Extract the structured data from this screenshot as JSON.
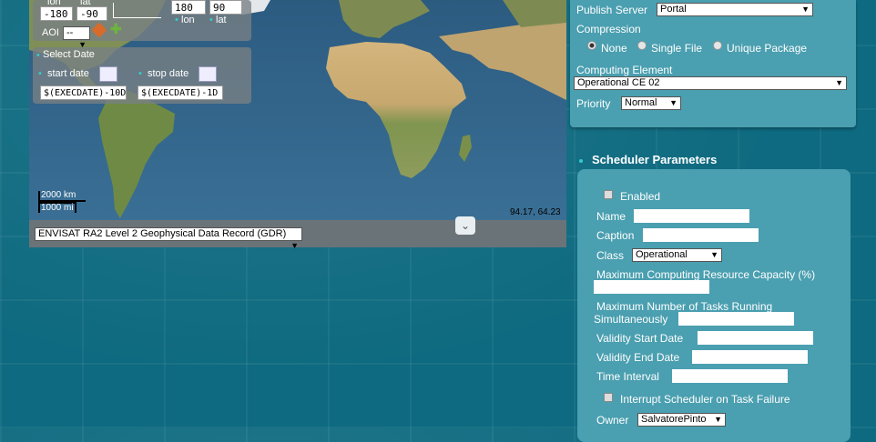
{
  "map": {
    "aoi": {
      "lon_label": "lon",
      "lat_label": "lat",
      "min_lon": "-180",
      "min_lat": "-90",
      "max_lon": "180",
      "max_lat": "90",
      "aoi_label": "AOI",
      "aoi_value": "--"
    },
    "select_date": {
      "title": "Select Date",
      "start_label": "start date",
      "stop_label": "stop date",
      "start_value": "$(EXECDATE)-10D",
      "stop_value": "$(EXECDATE)-1D"
    },
    "scale": {
      "km": "2000 km",
      "mi": "1000 mi"
    },
    "coords": "94.17, 64.23",
    "dataset": "ENVISAT RA2 Level 2 Geophysical Data Record (GDR)"
  },
  "publish": {
    "server_label": "Publish Server",
    "server_value": "Portal",
    "compression_label": "Compression",
    "compression_options": [
      "None",
      "Single File",
      "Unique Package"
    ],
    "compression_selected": "None",
    "computing_label": "Computing Element",
    "computing_value": "Operational CE 02",
    "priority_label": "Priority",
    "priority_value": "Normal"
  },
  "scheduler": {
    "title": "Scheduler Parameters",
    "enabled_label": "Enabled",
    "name_label": "Name",
    "caption_label": "Caption",
    "class_label": "Class",
    "class_value": "Operational",
    "max_capacity_label": "Maximum Computing Resource Capacity (%)",
    "max_tasks_label_1": "Maximum Number of Tasks Running",
    "max_tasks_label_2": "Simultaneously",
    "validity_start_label": "Validity Start Date",
    "validity_end_label": "Validity End Date",
    "time_interval_label": "Time Interval",
    "interrupt_label": "Interrupt Scheduler on Task Failure",
    "owner_label": "Owner",
    "owner_value": "SalvatorePinto"
  },
  "colors": {
    "background": "#0e6a80",
    "panel": "#4a9fb0",
    "ocean": "#2d5d82",
    "land": "#8a9a5e",
    "desert": "#c9ad77"
  }
}
